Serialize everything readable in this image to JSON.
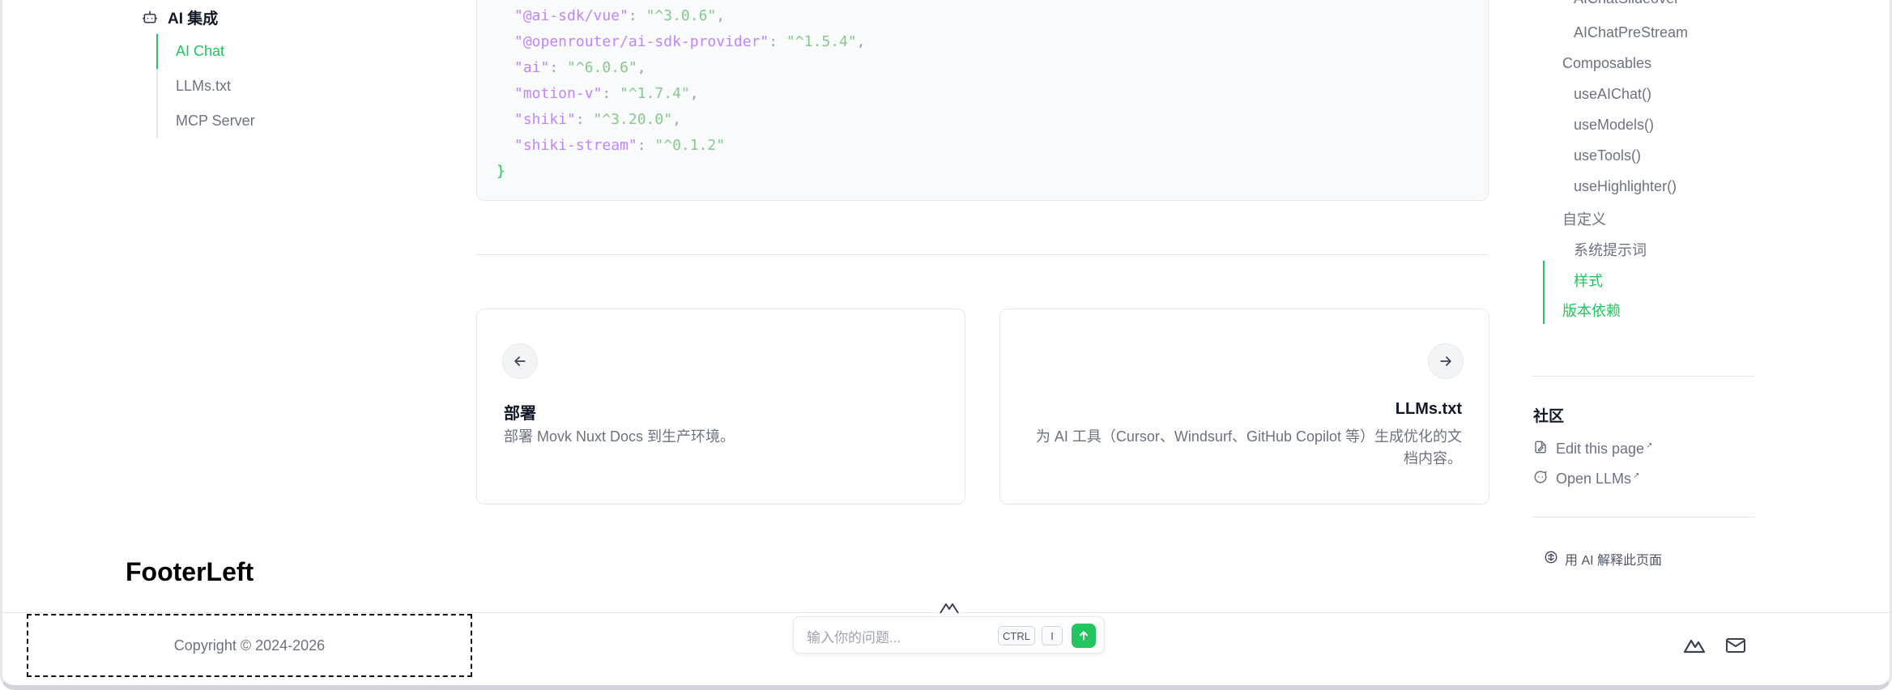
{
  "sidebar": {
    "group_label": "AI 集成",
    "items": [
      {
        "label": "AI Chat",
        "active": true
      },
      {
        "label": "LLMs.txt",
        "active": false
      },
      {
        "label": "MCP Server",
        "active": false
      }
    ]
  },
  "code": {
    "lines": [
      {
        "key": "\"@ai-sdk/vue\"",
        "value": "\"^3.0.6\"",
        "comma": ","
      },
      {
        "key": "\"@openrouter/ai-sdk-provider\"",
        "value": "\"^1.5.4\"",
        "comma": ","
      },
      {
        "key": "\"ai\"",
        "value": "\"^6.0.6\"",
        "comma": ","
      },
      {
        "key": "\"motion-v\"",
        "value": "\"^1.7.4\"",
        "comma": ","
      },
      {
        "key": "\"shiki\"",
        "value": "\"^3.20.0\"",
        "comma": ","
      },
      {
        "key": "\"shiki-stream\"",
        "value": "\"^0.1.2\"",
        "comma": ""
      }
    ],
    "closing": "}"
  },
  "pagination": {
    "prev": {
      "title": "部署",
      "description": "部署 Movk Nuxt Docs 到生产环境。"
    },
    "next": {
      "title": "LLMs.txt",
      "description": "为 AI 工具（Cursor、Windsurf、GitHub Copilot 等）生成优化的文档内容。"
    }
  },
  "toc": {
    "items": [
      {
        "label": "AIChatSlideover",
        "level": 2,
        "active": false
      },
      {
        "label": "AIChatPreStream",
        "level": 2,
        "active": false
      },
      {
        "label": "Composables",
        "level": 1,
        "active": false
      },
      {
        "label": "useAIChat()",
        "level": 2,
        "active": false
      },
      {
        "label": "useModels()",
        "level": 2,
        "active": false
      },
      {
        "label": "useTools()",
        "level": 2,
        "active": false
      },
      {
        "label": "useHighlighter()",
        "level": 2,
        "active": false
      },
      {
        "label": "自定义",
        "level": 1,
        "active": false
      },
      {
        "label": "系统提示词",
        "level": 2,
        "active": false
      },
      {
        "label": "样式",
        "level": 2,
        "active": true
      },
      {
        "label": "版本依赖",
        "level": 1,
        "active": true
      }
    ]
  },
  "community": {
    "title": "社区",
    "links": [
      {
        "label": "Edit this page",
        "icon": "file-edit-icon"
      },
      {
        "label": "Open LLMs",
        "icon": "chat-bubble-icon"
      }
    ],
    "ai_explain": "用 AI 解释此页面"
  },
  "annotation_label": "FooterLeft",
  "footer": {
    "copyright": "Copyright © 2024-2026",
    "chat_placeholder": "输入你的问题...",
    "kbd_ctrl": "CTRL",
    "kbd_i": "I"
  },
  "colors": {
    "accent": "#22c55e",
    "key": "#c084fc",
    "string": "#86c98a"
  }
}
